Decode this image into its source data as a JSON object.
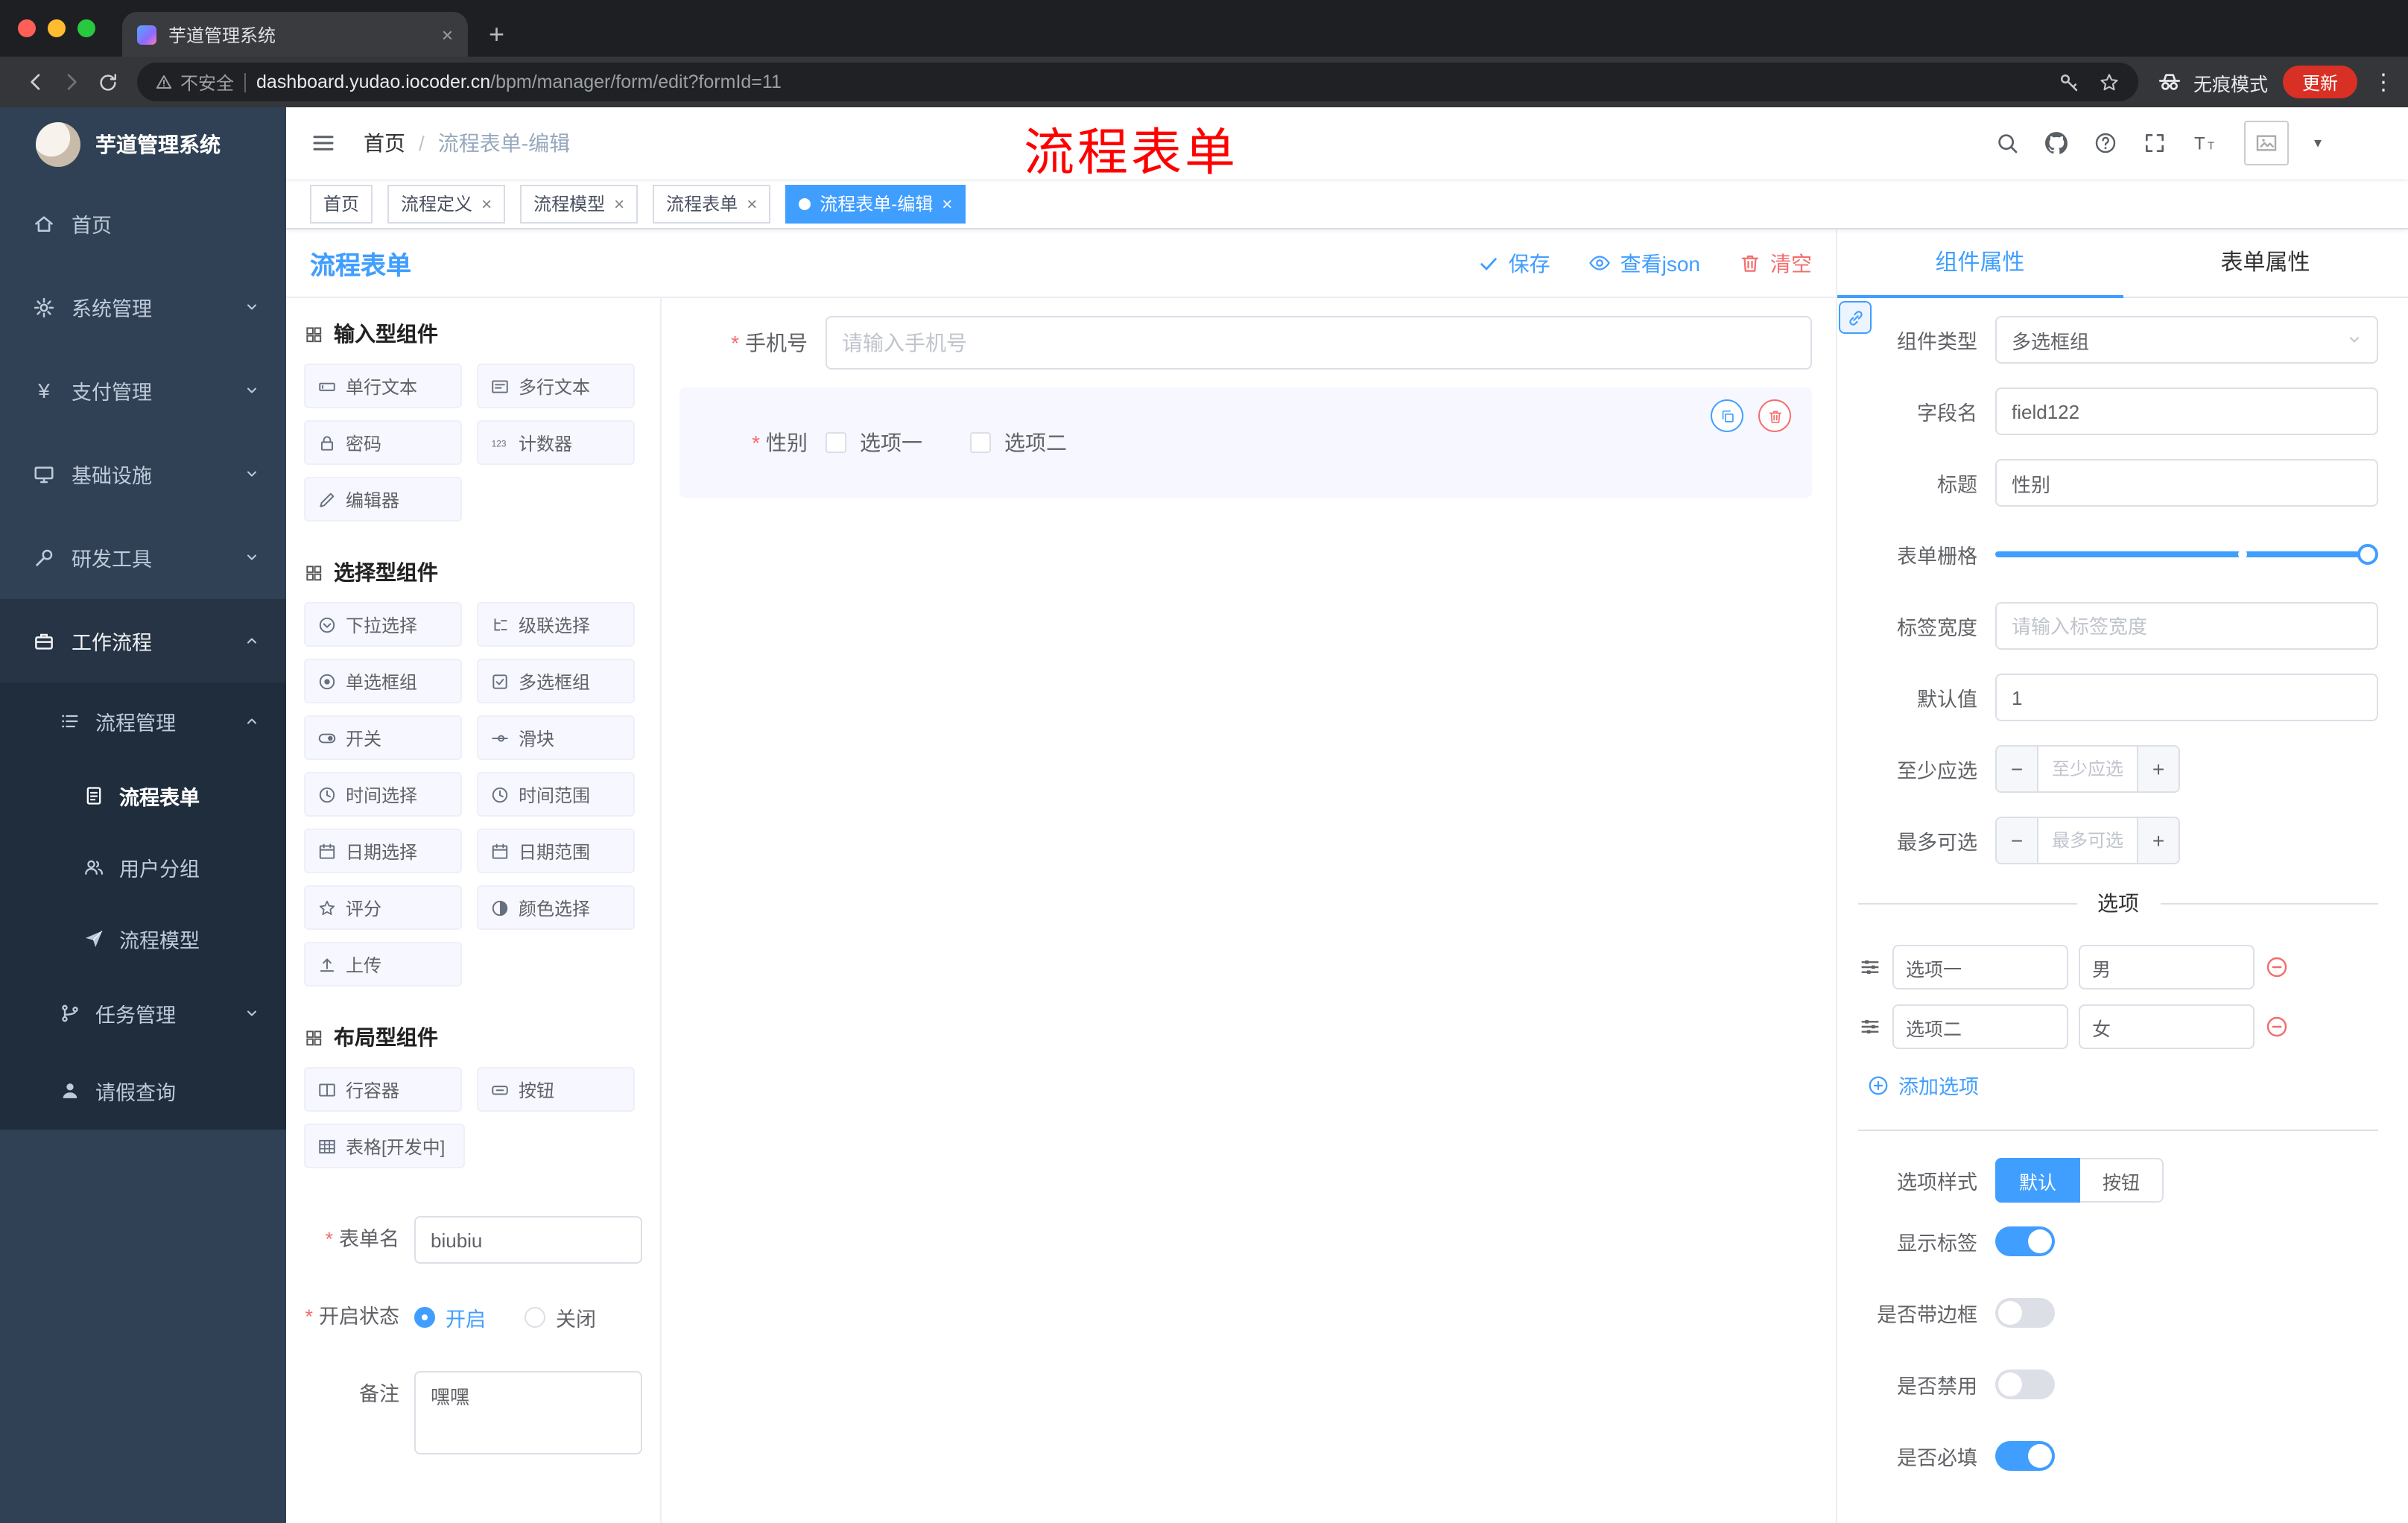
{
  "browser": {
    "tab_title": "芋道管理系统",
    "security_label": "不安全",
    "url_domain": "dashboard.yudao.iocoder.cn",
    "url_path": "/bpm/manager/form/edit?formId=11",
    "incognito_label": "无痕模式",
    "update_label": "更新"
  },
  "icons": {
    "close": "×",
    "new_tab": "+",
    "more": "⋮",
    "minus": "−",
    "plus": "+",
    "slash": "/",
    "caret": "▾",
    "yen": "¥"
  },
  "annotation": {
    "text": "流程表单",
    "color": "#ff0000"
  },
  "sidebar": {
    "logo_title": "芋道管理系统",
    "items": [
      {
        "label": "首页"
      },
      {
        "label": "系统管理"
      },
      {
        "label": "支付管理"
      },
      {
        "label": "基础设施"
      },
      {
        "label": "研发工具"
      },
      {
        "label": "工作流程"
      }
    ],
    "submenu": {
      "label": "流程管理",
      "children": [
        {
          "label": "流程表单",
          "active": true
        },
        {
          "label": "用户分组"
        },
        {
          "label": "流程模型"
        }
      ]
    },
    "more_items": [
      {
        "label": "任务管理"
      },
      {
        "label": "请假查询"
      }
    ]
  },
  "header": {
    "breadcrumb": [
      "首页",
      "流程表单-编辑"
    ]
  },
  "tags": [
    {
      "label": "首页"
    },
    {
      "label": "流程定义"
    },
    {
      "label": "流程模型"
    },
    {
      "label": "流程表单"
    },
    {
      "label": "流程表单-编辑",
      "active": true
    }
  ],
  "editor": {
    "title": "流程表单",
    "actions": {
      "save": "保存",
      "view_json": "查看json",
      "clear": "清空"
    },
    "palette": {
      "sections": [
        {
          "title": "输入型组件",
          "items": [
            "单行文本",
            "多行文本",
            "密码",
            "计数器",
            "编辑器"
          ]
        },
        {
          "title": "选择型组件",
          "items": [
            "下拉选择",
            "级联选择",
            "单选框组",
            "多选框组",
            "开关",
            "滑块",
            "时间选择",
            "时间范围",
            "日期选择",
            "日期范围",
            "评分",
            "颜色选择",
            "上传"
          ]
        },
        {
          "title": "布局型组件",
          "items": [
            "行容器",
            "按钮",
            "表格[开发中]"
          ]
        }
      ]
    },
    "meta": {
      "name_label": "表单名",
      "name_value": "biubiu",
      "status_label": "开启状态",
      "status_on": "开启",
      "status_off": "关闭",
      "remark_label": "备注",
      "remark_value": "嘿嘿"
    },
    "canvas": {
      "phone": {
        "label": "手机号",
        "placeholder": "请输入手机号"
      },
      "gender": {
        "label": "性别",
        "option1": "选项一",
        "option2": "选项二"
      }
    },
    "props": {
      "tab_component": "组件属性",
      "tab_form": "表单属性",
      "component_type_label": "组件类型",
      "component_type_value": "多选框组",
      "field_name_label": "字段名",
      "field_name_value": "field122",
      "title_label": "标题",
      "title_value": "性别",
      "grid_label": "表单栅格",
      "label_width_label": "标签宽度",
      "label_width_placeholder": "请输入标签宽度",
      "default_label": "默认值",
      "default_value": "1",
      "min_label": "至少应选",
      "min_placeholder": "至少应选",
      "max_label": "最多可选",
      "max_placeholder": "最多可选",
      "options_divider": "选项",
      "options": [
        {
          "label": "选项一",
          "value": "男"
        },
        {
          "label": "选项二",
          "value": "女"
        }
      ],
      "add_option": "添加选项",
      "style_label": "选项样式",
      "style_default": "默认",
      "style_button": "按钮",
      "switch_show_label": "显示标签",
      "switch_border": "是否带边框",
      "switch_disabled": "是否禁用",
      "switch_required": "是否必填"
    }
  },
  "colors": {
    "accent": "#409eff",
    "danger": "#f56c6c",
    "annotation": "#ff0000"
  }
}
